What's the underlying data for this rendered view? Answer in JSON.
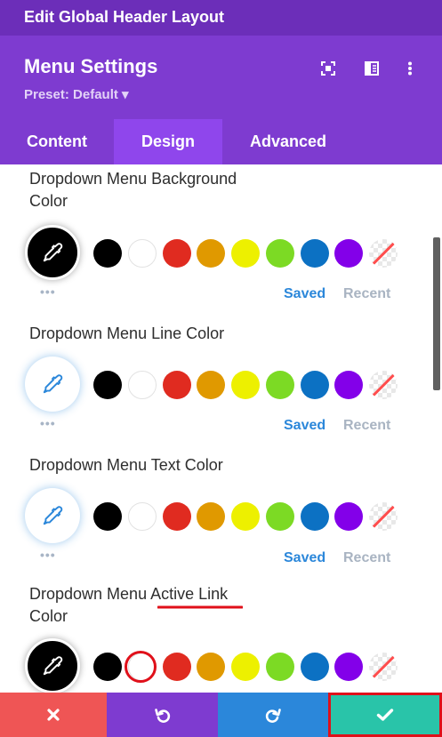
{
  "window": {
    "title": "Edit Global Header Layout"
  },
  "module": {
    "title": "Menu Settings",
    "preset": "Preset: Default ▾"
  },
  "tabs": [
    {
      "label": "Content"
    },
    {
      "label": "Design"
    },
    {
      "label": "Advanced"
    }
  ],
  "palette": [
    "#000000",
    "#ffffff",
    "#e02b20",
    "#e09900",
    "#edf000",
    "#7cda24",
    "#0c71c3",
    "#8300e9"
  ],
  "sections": [
    {
      "label": "Dropdown Menu Background Color",
      "saved": "Saved",
      "recent": "Recent"
    },
    {
      "label": "Dropdown Menu Line Color",
      "saved": "Saved",
      "recent": "Recent"
    },
    {
      "label": "Dropdown Menu Text Color",
      "saved": "Saved",
      "recent": "Recent"
    },
    {
      "label": "Dropdown Menu Active Link Color"
    }
  ],
  "dots": "•••",
  "colors": {
    "topbar": "#6c2eb9",
    "header": "#7e3bd0",
    "active_tab": "#8f46ec",
    "discard": "#ef5555",
    "undo": "#7e3bd0",
    "redo": "#2b87da",
    "save": "#29c4a9",
    "annotation_red": "#e0101a"
  }
}
